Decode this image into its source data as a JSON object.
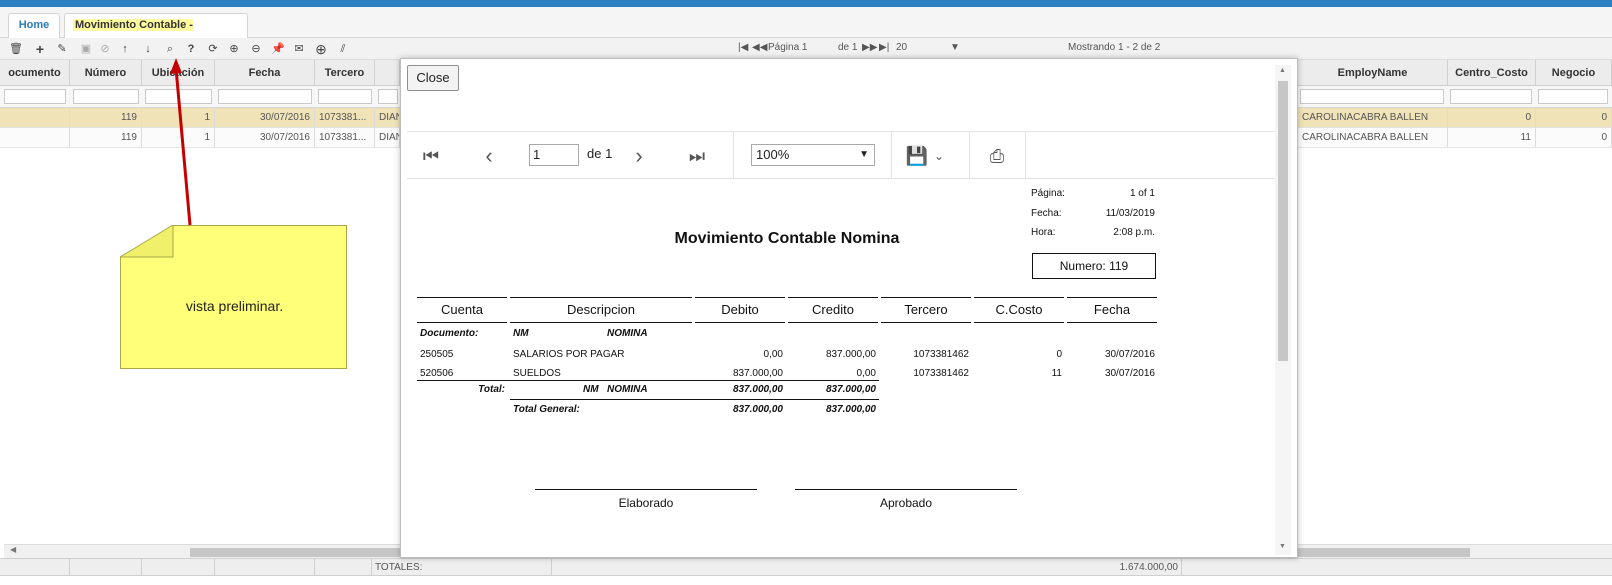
{
  "tabs": {
    "home": "Home",
    "active": "Movimiento Contable -[nnmc]",
    "close": "×"
  },
  "toolbar": {
    "icons": [
      "trash-icon",
      "plus-icon",
      "pencil-icon",
      "save-icon",
      "cancel-icon",
      "arrow-up-icon",
      "arrow-down-icon",
      "preview-icon",
      "help-icon",
      "refresh-icon",
      "zoom-in-icon",
      "zoom-out-icon",
      "pin-icon",
      "mail-icon",
      "add-circle-icon",
      "resize-icon"
    ],
    "pager": {
      "first": "|◀",
      "prev": "◀◀",
      "page_label": "Página 1",
      "of_label": "de 1",
      "next": "▶▶",
      "last": "▶|",
      "page_size": "20",
      "showing": "Mostrando 1 - 2 de 2"
    }
  },
  "grid": {
    "headers": [
      "ocumento",
      "Número",
      "Ubicación",
      "Fecha",
      "Tercero",
      "",
      "EmployName",
      "Centro_Costo",
      "Negocio"
    ],
    "rows": [
      {
        "numero": "119",
        "ubicacion": "1",
        "fecha": "30/07/2016",
        "tercero": "1073381...",
        "extra": "DIAN",
        "employ": "CAROLINACABRA BALLEN",
        "centro": "0",
        "negocio": "0"
      },
      {
        "numero": "119",
        "ubicacion": "1",
        "fecha": "30/07/2016",
        "tercero": "1073381...",
        "extra": "DIAN",
        "employ": "CAROLINACABRA BALLEN",
        "centro": "11",
        "negocio": "0"
      }
    ],
    "totales_label": "TOTALES:",
    "totales_value": "1.674.000,00"
  },
  "viewer": {
    "close_label": "Close",
    "page_input": "1",
    "page_of": "de 1",
    "zoom": "100%"
  },
  "report": {
    "title": "Movimiento Contable Nomina",
    "pagina_label": "Página:",
    "pagina_value": "1 of 1",
    "fecha_label": "Fecha:",
    "fecha_value": "11/03/2019",
    "hora_label": "Hora:",
    "hora_value": "2:08 p.m.",
    "numero": "Numero: 119",
    "columns": [
      "Cuenta",
      "Descripcion",
      "Debito",
      "Credito",
      "Tercero",
      "C.Costo",
      "Fecha"
    ],
    "doc_label": "Documento:",
    "doc_code": "NM",
    "doc_name": "NOMINA",
    "lines": [
      {
        "cuenta": "250505",
        "desc": "SALARIOS POR PAGAR",
        "debito": "0,00",
        "credito": "837.000,00",
        "tercero": "1073381462",
        "costo": "0",
        "fecha": "30/07/2016"
      },
      {
        "cuenta": "520506",
        "desc": "SUELDOS",
        "debito": "837.000,00",
        "credito": "0,00",
        "tercero": "1073381462",
        "costo": "11",
        "fecha": "30/07/2016"
      }
    ],
    "total_label": "Total:",
    "total_code": "NM",
    "total_name": "NOMINA",
    "total_debito": "837.000,00",
    "total_credito": "837.000,00",
    "general_label": "Total General:",
    "general_debito": "837.000,00",
    "general_credito": "837.000,00",
    "sig_left": "Elaborado",
    "sig_right": "Aprobado"
  },
  "note": {
    "text": "vista preliminar."
  },
  "colors": {
    "accent": "#2c7fc0",
    "note": "#ffff7a",
    "arrow": "#c40000",
    "selected_row": "#f0e3b8"
  }
}
